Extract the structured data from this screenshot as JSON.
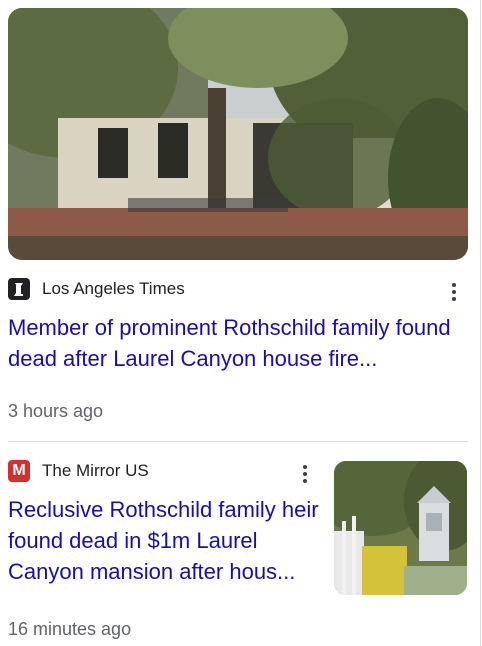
{
  "articles": [
    {
      "source": "Los Angeles Times",
      "source_logo": "lat-logo-icon",
      "source_logo_color": "#202124",
      "headline": "Member of prominent Rothschild family found dead after Laurel Canyon house fire...",
      "time": "3 hours ago"
    },
    {
      "source": "The Mirror US",
      "source_logo": "mirror-logo-icon",
      "source_logo_color": "#d32f2f",
      "headline": "Reclusive Rothschild family heir found dead in $1m Laurel Canyon mansion after hous...",
      "time": "16 minutes ago"
    }
  ],
  "colors": {
    "headline_link": "#1a0dab",
    "meta_text": "#5f6368",
    "divider": "#dadce0"
  }
}
